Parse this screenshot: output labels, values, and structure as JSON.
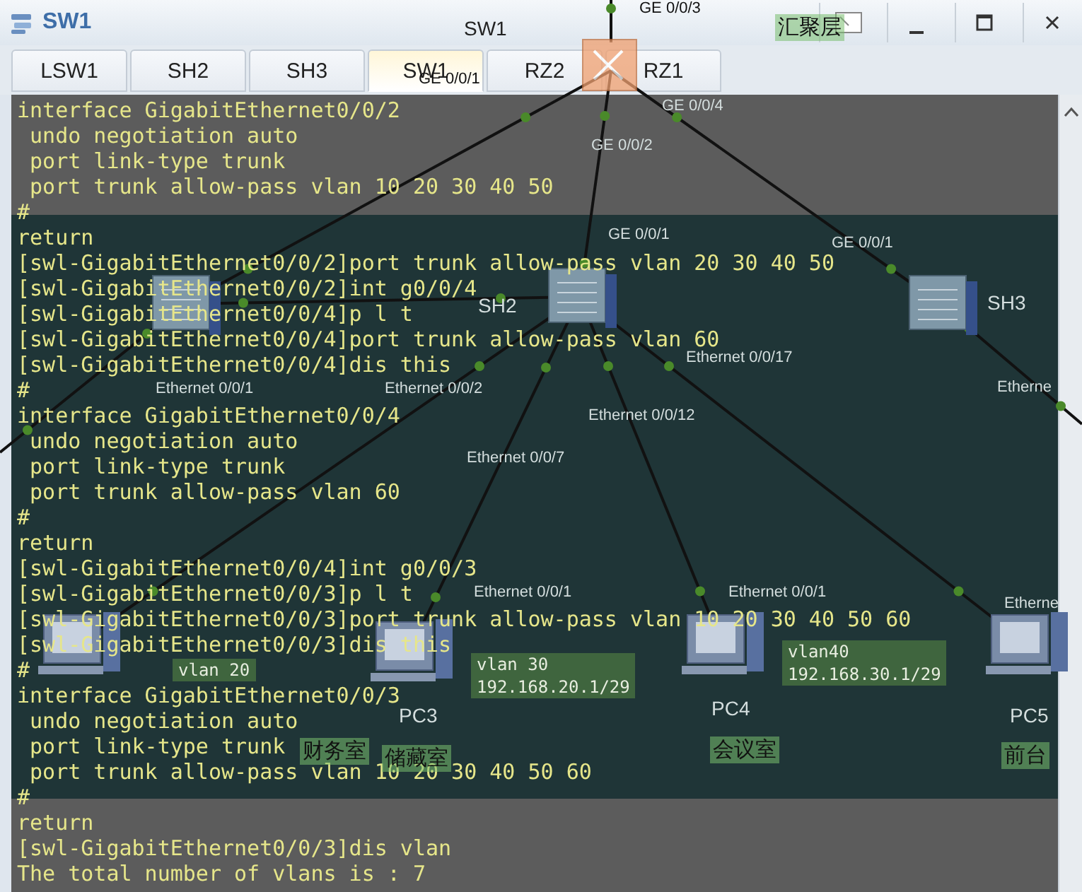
{
  "window": {
    "title": "SW1"
  },
  "tabs": [
    {
      "label": "LSW1",
      "selected": false
    },
    {
      "label": "SH2",
      "selected": false
    },
    {
      "label": "SH3",
      "selected": false
    },
    {
      "label": "SW1",
      "selected": true
    },
    {
      "label": "RZ2",
      "selected": false
    },
    {
      "label": "RZ1",
      "selected": false
    }
  ],
  "console": {
    "lines": [
      "interface GigabitEthernet0/0/2",
      " undo negotiation auto",
      " port link-type trunk",
      " port trunk allow-pass vlan 10 20 30 40 50",
      "#",
      "return",
      "[swl-GigabitEthernet0/0/2]port trunk allow-pass vlan 20 30 40 50",
      "[swl-GigabitEthernet0/0/2]int g0/0/4",
      "[swl-GigabitEthernet0/0/4]p l t",
      "[swl-GigabitEthernet0/0/4]port trunk allow-pass vlan 60",
      "[swl-GigabitEthernet0/0/4]dis this",
      "#",
      "interface GigabitEthernet0/0/4",
      " undo negotiation auto",
      " port link-type trunk",
      " port trunk allow-pass vlan 60",
      "#",
      "return",
      "[swl-GigabitEthernet0/0/4]int g0/0/3",
      "[swl-GigabitEthernet0/0/3]p l t",
      "[swl-GigabitEthernet0/0/3]port trunk allow-pass vlan 10 20 30 40 50 60",
      "[swl-GigabitEthernet0/0/3]dis this",
      "#",
      "interface GigabitEthernet0/0/3",
      " undo negotiation auto",
      " port link-type trunk",
      " port trunk allow-pass vlan 10 20 30 40 50 60",
      "#",
      "return",
      "[swl-GigabitEthernet0/0/3]dis vlan",
      "The total number of vlans is : 7"
    ]
  },
  "topology": {
    "devices": [
      {
        "kind": "router",
        "name": "SW1"
      },
      {
        "kind": "switch"
      },
      {
        "kind": "switch",
        "name": "SH2"
      },
      {
        "kind": "switch",
        "name": "SH3"
      },
      {
        "kind": "pc"
      },
      {
        "kind": "pc",
        "name": "PC3"
      },
      {
        "kind": "pc",
        "name": "PC4"
      },
      {
        "kind": "pc",
        "name": "PC5"
      }
    ],
    "port_labels": [
      "GE 0/0/3",
      "GE 0/0/1",
      "GE 0/0/4",
      "GE 0/0/2",
      "GE 0/0/1",
      "GE 0/0/1",
      "Ethernet 0/0/1",
      "Ethernet 0/0/2",
      "Ethernet 0/0/17",
      "Ethernet 0/0/12",
      "Ethernet 0/0/7",
      "Ethernet 0/0/1",
      "Ethernet 0/0/1",
      "Etherne",
      "Etherne"
    ],
    "notes": [
      {
        "lines": [
          "vlan 20"
        ]
      },
      {
        "lines": [
          "vlan 30",
          "192.168.20.1/29"
        ]
      },
      {
        "lines": [
          "vlan40",
          "192.168.30.1/29"
        ]
      }
    ],
    "area_labels": [
      "汇聚层",
      "财务室",
      "储藏室",
      "会议室",
      "前台"
    ]
  }
}
